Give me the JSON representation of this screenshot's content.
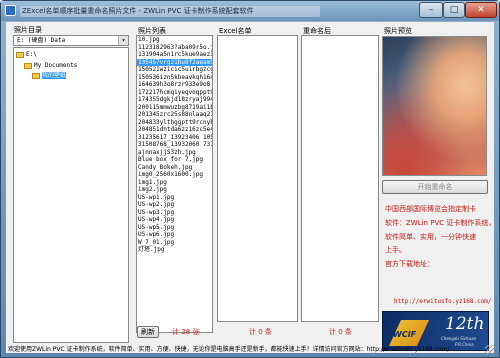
{
  "window": {
    "title": "ZExcel名单顺序批量重命名照片文件 - ZWLin PVC 证卡制作系统配套软件"
  },
  "titlebar_buttons": {
    "minimize": "–",
    "maximize": "□",
    "close": "✕"
  },
  "panels": {
    "photo_dir": "照片目录",
    "photo_list": "照片列表",
    "excel_list": "Excel名单",
    "renamed": "重命名后",
    "preview": "照片预览"
  },
  "drive_select": {
    "value": "E: (硬盘) Data",
    "arrow": "▾"
  },
  "tree": [
    {
      "label": "E:\\",
      "level": 0,
      "selected": false
    },
    {
      "label": "My Documents",
      "level": 1,
      "selected": false
    },
    {
      "label": "我的壁纸",
      "level": 2,
      "selected": true
    }
  ],
  "photo_list_items": [
    "10.jpg",
    "1123182963?aba09r5o.jp",
    "131904a5n1rc5kue9aez3w",
    "135457vrg21hu9f2aeam9r",
    "150521wzicic5uirbgzcg",
    "150536izn5kbeavkqh16ni",
    "164639h3o8rzr933e9o8",
    "172217hcmqiyeqvoqppt9",
    "174355dgkjd18zryaj994",
    "200115mmwuzbg8719ai1bz",
    "201345zrc25s88nlaaq21n",
    "204833ylthggptt9rcnyb",
    "204851dntda6zz16zc5e4r",
    "31235617_13923406 10564",
    "31508768_13932060 73190",
    "ajnnaxjjS3zh.jpg",
    "Blue box  for 7.jpg",
    "Candy Bokeh.jpg",
    "img0_2560x1600.jpg",
    "img1.jpg",
    "img2.jpg",
    "US-wp1.jpg",
    "US-wp2.jpg",
    "US-wp3.jpg",
    "US-wp4.jpg",
    "US-wp5.jpg",
    "US-wp6.jpg",
    "W_7_01.jpg",
    "灯塔.jpg"
  ],
  "buttons": {
    "refresh": "刷新",
    "rename": "开始重命名"
  },
  "counts": {
    "photos": "计 28 张",
    "excel": "计 0 条",
    "renamed": "计 0 条"
  },
  "info": {
    "line1": "中国西部国际博览会指定制卡",
    "line2": "软件：ZWLin PVC 证卡制作系统，",
    "line3": "软件简单、实用，一分钟快速",
    "line4": "上手。",
    "line5": "官方下载地址：",
    "url": "http://erwitusfo.yz168.com/"
  },
  "banner": {
    "big": "12th",
    "sub": "Chengdu Sichuan",
    "sub2": "P.R.China",
    "brand": "WCIF"
  },
  "status": {
    "text": "欢迎使用ZWLin PVC 证卡制作系统，软件简单、实用、方便、快捷，无论你是电脑高手还是新手，都能快速上手！详情访问官方网站：http://erwitusfo.yz168.com/"
  },
  "colors": {
    "selection": "#3399ff",
    "count_red": "#d02010",
    "info_red": "#cc1a1a",
    "banner_blue": "#0d2c64"
  }
}
